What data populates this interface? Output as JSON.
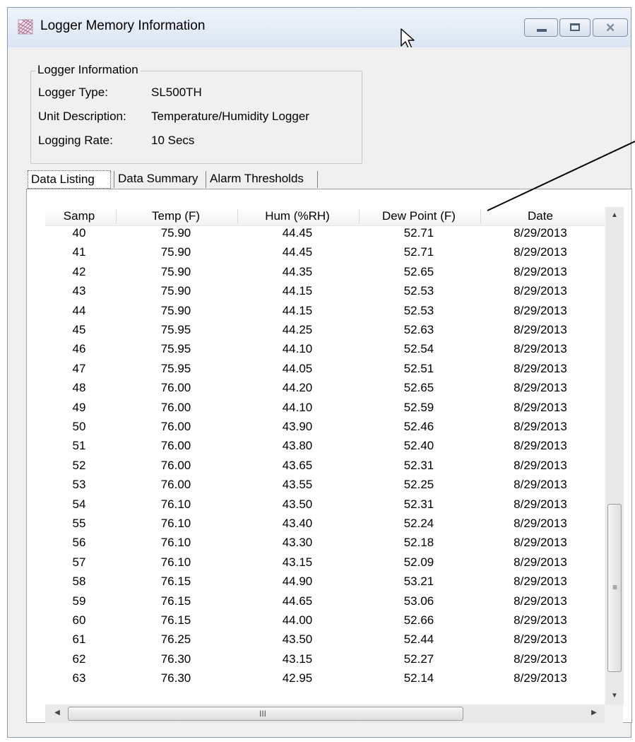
{
  "window": {
    "title": "Logger Memory Information",
    "icon": "grid-app-icon",
    "buttons": {
      "minimize": "minimize-icon",
      "maximize": "maximize-icon",
      "close": "close-icon"
    }
  },
  "logger_info": {
    "legend": "Logger Information",
    "rows": [
      {
        "label": "Logger Type:",
        "value": "SL500TH"
      },
      {
        "label": "Unit Description:",
        "value": "Temperature/Humidity Logger"
      },
      {
        "label": "Logging Rate:",
        "value": "10 Secs"
      }
    ]
  },
  "tabs": [
    "Data Listing",
    "Data Summary",
    "Alarm Thresholds"
  ],
  "active_tab": "Data Listing",
  "table": {
    "columns": [
      "Samp",
      "Temp (F)",
      "Hum (%RH)",
      "Dew Point (F)",
      "Date"
    ],
    "rows": [
      [
        "40",
        "75.90",
        "44.45",
        "52.71",
        "8/29/2013"
      ],
      [
        "41",
        "75.90",
        "44.45",
        "52.71",
        "8/29/2013"
      ],
      [
        "42",
        "75.90",
        "44.35",
        "52.65",
        "8/29/2013"
      ],
      [
        "43",
        "75.90",
        "44.15",
        "52.53",
        "8/29/2013"
      ],
      [
        "44",
        "75.90",
        "44.15",
        "52.53",
        "8/29/2013"
      ],
      [
        "45",
        "75.95",
        "44.25",
        "52.63",
        "8/29/2013"
      ],
      [
        "46",
        "75.95",
        "44.10",
        "52.54",
        "8/29/2013"
      ],
      [
        "47",
        "75.95",
        "44.05",
        "52.51",
        "8/29/2013"
      ],
      [
        "48",
        "76.00",
        "44.20",
        "52.65",
        "8/29/2013"
      ],
      [
        "49",
        "76.00",
        "44.10",
        "52.59",
        "8/29/2013"
      ],
      [
        "50",
        "76.00",
        "43.90",
        "52.46",
        "8/29/2013"
      ],
      [
        "51",
        "76.00",
        "43.80",
        "52.40",
        "8/29/2013"
      ],
      [
        "52",
        "76.00",
        "43.65",
        "52.31",
        "8/29/2013"
      ],
      [
        "53",
        "76.00",
        "43.55",
        "52.25",
        "8/29/2013"
      ],
      [
        "54",
        "76.10",
        "43.50",
        "52.31",
        "8/29/2013"
      ],
      [
        "55",
        "76.10",
        "43.40",
        "52.24",
        "8/29/2013"
      ],
      [
        "56",
        "76.10",
        "43.30",
        "52.18",
        "8/29/2013"
      ],
      [
        "57",
        "76.10",
        "43.15",
        "52.09",
        "8/29/2013"
      ],
      [
        "58",
        "76.15",
        "44.90",
        "53.21",
        "8/29/2013"
      ],
      [
        "59",
        "76.15",
        "44.65",
        "53.06",
        "8/29/2013"
      ],
      [
        "60",
        "76.15",
        "44.00",
        "52.66",
        "8/29/2013"
      ],
      [
        "61",
        "76.25",
        "43.50",
        "52.44",
        "8/29/2013"
      ],
      [
        "62",
        "76.30",
        "43.15",
        "52.27",
        "8/29/2013"
      ],
      [
        "63",
        "76.30",
        "42.95",
        "52.14",
        "8/29/2013"
      ]
    ]
  },
  "scrollbars": {
    "vertical": {
      "up": "scroll-up-arrow-icon",
      "down": "scroll-down-arrow-icon",
      "grip": "≡"
    },
    "horizontal": {
      "left": "scroll-left-arrow-icon",
      "right": "scroll-right-arrow-icon",
      "grip": "III"
    }
  },
  "colors": {
    "titlebar": "#dbe6f3",
    "window_bg": "#f0f0f0",
    "list_bg": "#ffffff",
    "callout_line": "#000000"
  }
}
